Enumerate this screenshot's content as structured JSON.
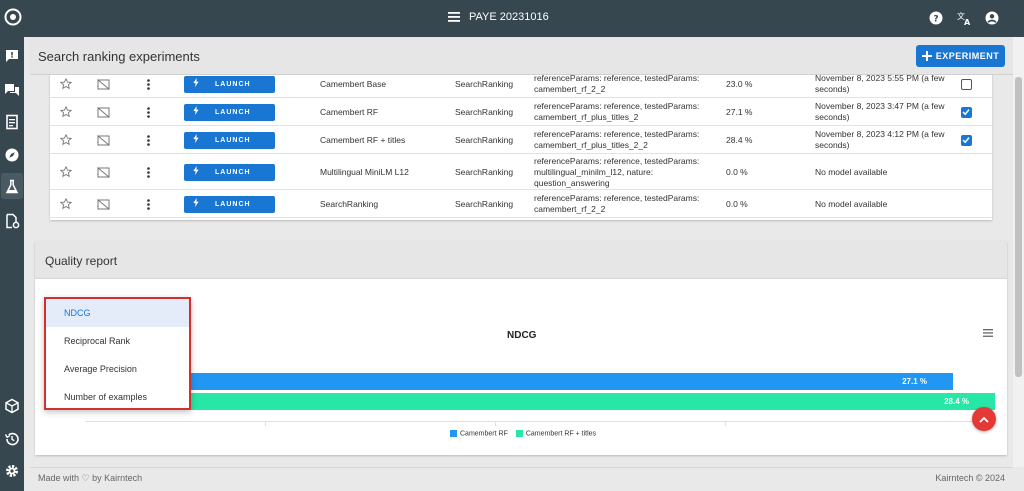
{
  "header": {
    "title": "PAYE 20231016",
    "icons": [
      "menu-icon",
      "help-icon",
      "translate-icon",
      "account-icon"
    ]
  },
  "rail": {
    "icons": [
      "feedback-icon",
      "forum-icon",
      "documents-icon",
      "explore-icon",
      "experiments-icon",
      "doc-settings-icon",
      "package-icon",
      "history-icon",
      "settings-icon"
    ]
  },
  "page": {
    "title": "Search ranking experiments",
    "add_button": "EXPERIMENT"
  },
  "table": {
    "launch_label": "LAUNCH",
    "rows": [
      {
        "name": "Camembert Base",
        "type": "SearchRanking",
        "params1": "referenceParams: reference, testedParams:",
        "params2": "camembert_rf_2_2",
        "params3": "",
        "score": "23.0 %",
        "date1": "November 8, 2023 5:55 PM (a few",
        "date2": "seconds)",
        "checked": false,
        "has_checkbox": true
      },
      {
        "name": "Camembert RF",
        "type": "SearchRanking",
        "params1": "referenceParams: reference, testedParams:",
        "params2": "camembert_rf_plus_titles_2",
        "params3": "",
        "score": "27.1 %",
        "date1": "November 8, 2023 3:47 PM (a few",
        "date2": "seconds)",
        "checked": true,
        "has_checkbox": true
      },
      {
        "name": "Camembert RF + titles",
        "type": "SearchRanking",
        "params1": "referenceParams: reference, testedParams:",
        "params2": "camembert_rf_plus_titles_2_2",
        "params3": "",
        "score": "28.4 %",
        "date1": "November 8, 2023 4:12 PM (a few",
        "date2": "seconds)",
        "checked": true,
        "has_checkbox": true
      },
      {
        "name": "Multilingual MiniLM L12",
        "type": "SearchRanking",
        "params1": "referenceParams: reference, testedParams:",
        "params2": "multilingual_minilm_l12, nature:",
        "params3": "question_answering",
        "score": "0.0 %",
        "date1": "No model available",
        "date2": "",
        "checked": false,
        "has_checkbox": false
      },
      {
        "name": "SearchRanking",
        "type": "SearchRanking",
        "params1": "referenceParams: reference, testedParams:",
        "params2": "camembert_rf_2_2",
        "params3": "",
        "score": "0.0 %",
        "date1": "No model available",
        "date2": "",
        "checked": false,
        "has_checkbox": false
      }
    ]
  },
  "quality": {
    "title": "Quality report",
    "metric_menu": [
      "NDCG",
      "Reciprocal Rank",
      "Average Precision",
      "Number of examples"
    ],
    "selected_metric": "NDCG"
  },
  "chart_data": {
    "type": "bar",
    "orientation": "horizontal",
    "title": "NDCG",
    "xlabel": "",
    "ylabel": "",
    "series": [
      {
        "name": "Camembert RF",
        "values": [
          27.1
        ],
        "label": "27.1 %",
        "color": "#2196f3"
      },
      {
        "name": "Camembert RF + titles",
        "values": [
          28.4
        ],
        "label": "28.4 %",
        "color": "#26e7a6"
      }
    ],
    "xlim": [
      0,
      28.4
    ],
    "legend": "bottom",
    "grid": true
  },
  "footer": {
    "left": "Made with ♡ by Kairntech",
    "right": "Kairntech © 2024"
  },
  "colors": {
    "primary": "#1976d2",
    "topbar": "#37474f",
    "fab": "#e53935",
    "menu_outline": "#d32f2f"
  }
}
